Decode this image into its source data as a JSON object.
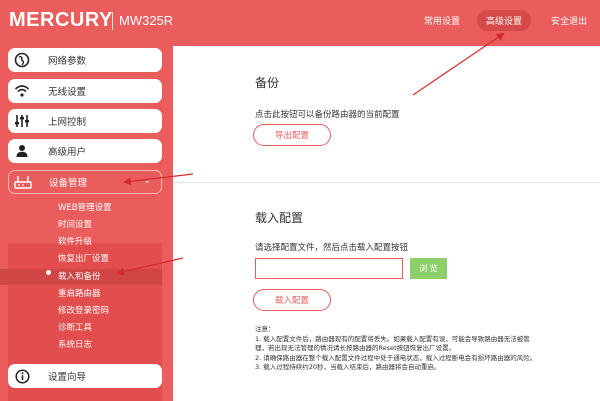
{
  "header": {
    "logo_text": "MERCURY",
    "model": "MW325R",
    "nav": [
      "常用设置",
      "高级设置",
      "安全退出"
    ],
    "active_nav": "高级设置"
  },
  "sidebar": {
    "items": [
      {
        "label": "网络参数",
        "icon": "globe-icon"
      },
      {
        "label": "无线设置",
        "icon": "wifi-icon"
      },
      {
        "label": "上网控制",
        "icon": "sliders-icon"
      },
      {
        "label": "高级用户",
        "icon": "user-icon"
      },
      {
        "label": "设备管理",
        "icon": "router-icon"
      },
      {
        "label": "设置向导",
        "icon": "info-icon"
      }
    ],
    "submenu": [
      "WEB管理设置",
      "时间设置",
      "软件升级",
      "恢复出厂设置",
      "载入和备份",
      "重启路由器",
      "修改登录密码",
      "诊断工具",
      "系统日志"
    ],
    "active_submenu": "载入和备份"
  },
  "backup": {
    "title": "备份",
    "description": "点击此按钮可以备份路由器的当前配置",
    "export_label": "导出配置"
  },
  "restore": {
    "title": "载入配置",
    "description": "请选择配置文件，然后点击载入配置按钮",
    "file_value": "",
    "browse_label": "浏 览",
    "load_label": "载入配置"
  },
  "notes": {
    "heading": "注意：",
    "lines": [
      "1. 载入配置文件后，路由器现有的配置将丢失。如果载入配置有误，可能会导致路由器无法被管",
      "    理，若出现无法管理的情况请长按路由器的Reset按钮恢复出厂设置。",
      "2. 请确保路由器在整个载入配置文件过程中处于通电状态，载入过程断电会有损坏路由器的风险。",
      "3. 载入过程持续约20秒，当载入结束后，路由器将会自动重启。"
    ]
  },
  "colors": {
    "brand": "#ea5d5c",
    "accent_green": "#8ccf6b",
    "arrow": "#d42a2a"
  }
}
